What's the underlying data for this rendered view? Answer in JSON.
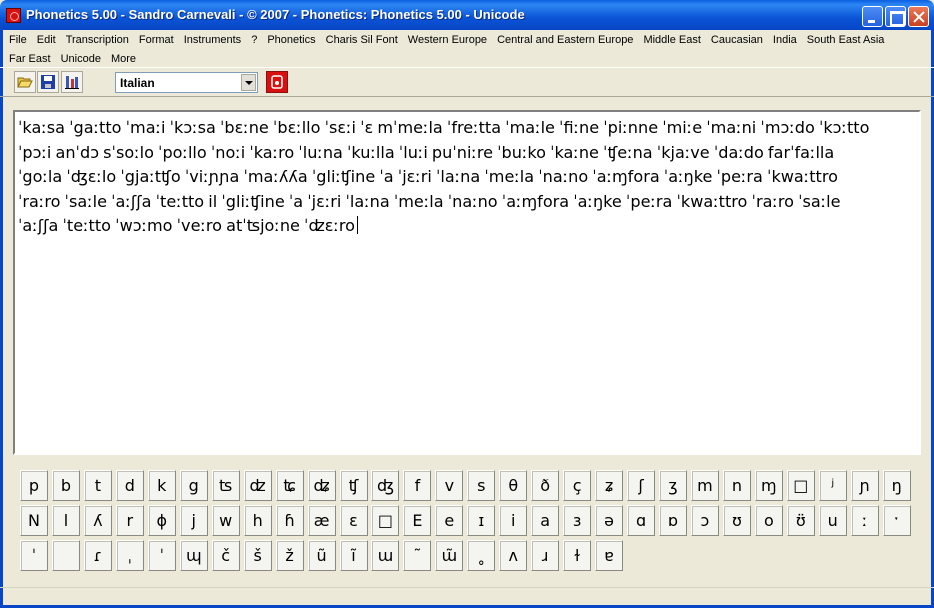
{
  "window": {
    "title": "Phonetics 5.00 - Sandro Carnevali - ©  2007 - Phonetics: Phonetics 5.00 - Unicode"
  },
  "menu_row1": [
    "File",
    "Edit",
    "Transcription",
    "Format",
    "Instruments",
    "?",
    "Phonetics",
    "Charis Sil Font",
    "Western Europe",
    "Central and Eastern Europe",
    "Middle East",
    "Caucasian",
    "India",
    "South East Asia"
  ],
  "menu_row2": [
    "Far East",
    "Unicode",
    "More"
  ],
  "toolbar": {
    "language": "Italian"
  },
  "editor": {
    "lines": [
      "ˈkaːsa ˈgaːtto ˈmaːi ˈkɔːsa ˈbɛːne ˈbɛːllo ˈsɛːi ˈɛ mˈmeːla ˈfreːtta ˈmaːle ˈfiːne ˈpiːnne ˈmiːe ˈmaːni ˈmɔːdo ˈkɔːtto",
      "ˈpɔːi anˈdɔ sˈsoːlo ˈpoːllo ˈnoːi ˈkaːro ˈluːna ˈkuːlla ˈluːi puˈniːre ˈbuːko ˈkaːne ˈʧeːna ˈkjaːve ˈdaːdo farˈfaːlla",
      "ˈgoːla ˈʤɛːlo ˈgjaːtʧo ˈviːɲɲa ˈmaːʎʎa ˈgliːʧine ˈa ˈjɛːri ˈlaːna ˈmeːla ˈnaːno ˈaːɱfora ˈaːŋke ˈpeːra ˈkwaːttro",
      "ˈraːro ˈsaːle ˈaːʃʃa ˈteːtto il ˈgliːʧine ˈa ˈjɛːri ˈlaːna ˈmeːla ˈnaːno ˈaːɱfora ˈaːŋke ˈpeːra ˈkwaːttro ˈraːro ˈsaːle",
      "ˈaːʃʃa ˈteːtto ˈwɔːmo ˈveːro atˈʦjoːne ˈʣɛːro"
    ]
  },
  "keyboard": {
    "row1": [
      "p",
      "b",
      "t",
      "d",
      "k",
      "g",
      "ʦ",
      "ʣ",
      "ʨ",
      "ʥ",
      "ʧ",
      "ʤ",
      "f",
      "v",
      "s",
      "θ",
      "ð",
      "ç",
      "ʑ",
      "ʃ",
      "ʒ",
      "m",
      "n",
      "ɱ",
      "□",
      "ʲ",
      "ɲ",
      "ŋ"
    ],
    "row2": [
      "N",
      "l",
      "ʎ",
      "r",
      "ɸ",
      "j",
      "w",
      "h",
      "ɦ",
      "æ",
      "ɛ",
      "□",
      "E",
      "e",
      "ɪ",
      "i",
      "a",
      "ɜ",
      "ə",
      "ɑ",
      "ɒ",
      "ɔ",
      "ʊ",
      "o",
      "ʊ̈",
      "u",
      "ː",
      "ˑ"
    ],
    "row3": [
      "ˈ",
      "",
      "ɾ",
      "ˌ",
      "ˈ",
      "ɰ",
      "č",
      "š",
      "ž",
      "ũ",
      "ĩ",
      "ɯ",
      "˜",
      "ɯ̃",
      "˳",
      "ʌ",
      "ɹ",
      "ɫ",
      "ɐ"
    ]
  }
}
